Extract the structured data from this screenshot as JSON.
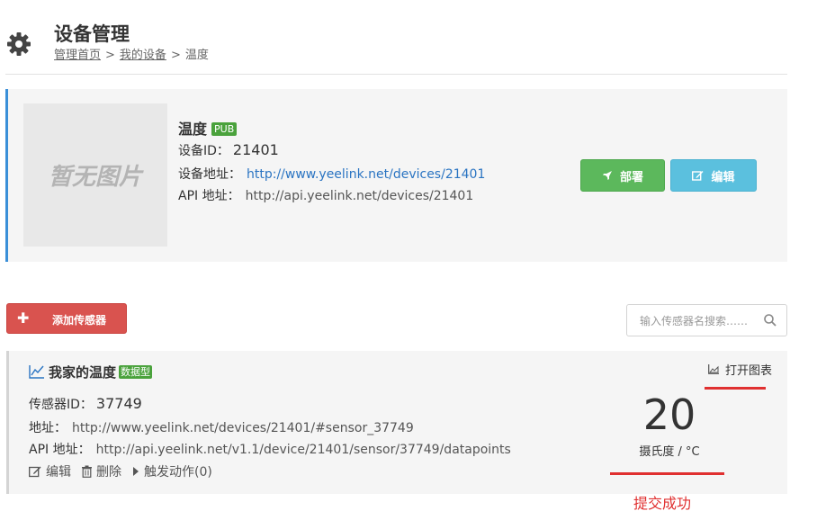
{
  "header": {
    "title": "设备管理",
    "breadcrumb": [
      {
        "label": "管理首页",
        "link": true
      },
      {
        "label": "我的设备",
        "link": true
      },
      {
        "label": "温度",
        "link": false
      }
    ],
    "separator": ">"
  },
  "device": {
    "no_image_text": "暂无图片",
    "name": "温度",
    "badge": "PUB",
    "id_label": "设备ID：",
    "id_value": "21401",
    "address_label": "设备地址：",
    "address_value": "http://www.yeelink.net/devices/21401",
    "api_label": "API 地址：",
    "api_value": "http://api.yeelink.net/devices/21401",
    "deploy_label": "部署",
    "edit_label": "编辑"
  },
  "toolbar": {
    "add_sensor_label": "添加传感器",
    "search_placeholder": "输入传感器名搜索……"
  },
  "sensor": {
    "name": "我家的温度",
    "badge": "数据型",
    "id_label": "传感器ID：",
    "id_value": "37749",
    "address_label": "地址：",
    "address_value": "http://www.yeelink.net/devices/21401/#sensor_37749",
    "api_label": "API 地址：",
    "api_value": "http://api.yeelink.net/v1.1/device/21401/sensor/37749/datapoints",
    "edit_label": "编辑",
    "delete_label": "删除",
    "trigger_label": "触发动作(0)",
    "open_chart_label": "打开图表",
    "value": "20",
    "unit": "摄氏度 / °C"
  },
  "annotation": {
    "text": "提交成功",
    "color": "#e03030"
  },
  "colors": {
    "accent_blue": "#3a8fd8",
    "deploy_green": "#5cb85c",
    "edit_cyan": "#5bc0de",
    "add_red": "#d9534f",
    "badge_green": "#4aa23c"
  }
}
